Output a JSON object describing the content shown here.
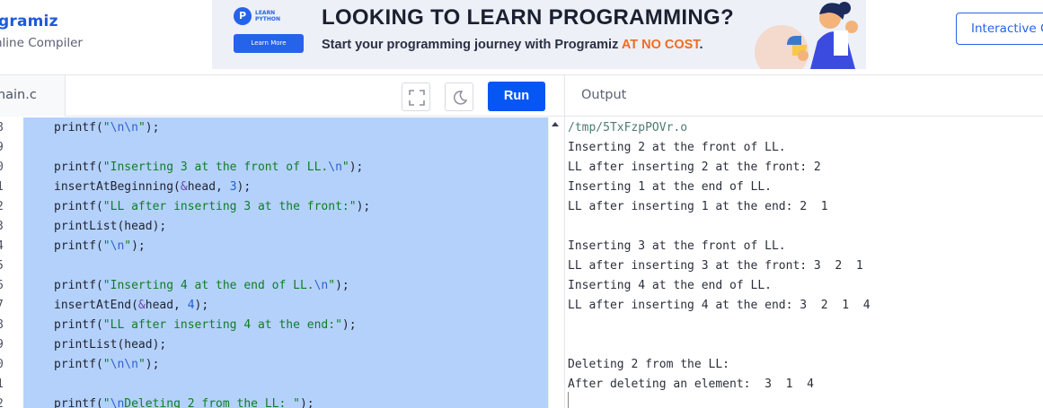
{
  "header": {
    "brand": "gramiz",
    "sub_brand": "nline Compiler",
    "interactive_button": "Interactive C"
  },
  "banner": {
    "logo_text_1": "LEARN",
    "logo_text_2": "PYTHON",
    "learn_more": "Learn More",
    "headline": "LOOKING TO LEARN PROGRAMMING?",
    "sub_prefix": "Start your programming journey with Programiz ",
    "sub_accent": "AT NO COST",
    "sub_suffix": ".",
    "accent_color": "#f26b21"
  },
  "editor": {
    "file_tab": "main.c",
    "run_label": "Run",
    "fullscreen_icon": "expand-icon",
    "theme_icon": "moon-icon",
    "selection_color": "#b4d1fb",
    "lines": [
      {
        "num": "8",
        "tokens": [
          [
            "plain",
            "printf("
          ],
          [
            "str",
            "\""
          ],
          [
            "esc",
            "\\n\\n"
          ],
          [
            "str",
            "\""
          ],
          [
            "plain",
            ");"
          ]
        ]
      },
      {
        "num": "9",
        "tokens": []
      },
      {
        "num": "0",
        "tokens": [
          [
            "plain",
            "printf("
          ],
          [
            "str",
            "\"Inserting 3 at the front of LL."
          ],
          [
            "esc",
            "\\n"
          ],
          [
            "str",
            "\""
          ],
          [
            "plain",
            ");"
          ]
        ]
      },
      {
        "num": "1",
        "tokens": [
          [
            "plain",
            "insertAtBeginning("
          ],
          [
            "op",
            "&"
          ],
          [
            "plain",
            "head, "
          ],
          [
            "num",
            "3"
          ],
          [
            "plain",
            ");"
          ]
        ]
      },
      {
        "num": "2",
        "tokens": [
          [
            "plain",
            "printf("
          ],
          [
            "str",
            "\"LL after inserting 3 at the front:\""
          ],
          [
            "plain",
            ");"
          ]
        ]
      },
      {
        "num": "3",
        "tokens": [
          [
            "plain",
            "printList(head);"
          ]
        ]
      },
      {
        "num": "4",
        "tokens": [
          [
            "plain",
            "printf("
          ],
          [
            "str",
            "\""
          ],
          [
            "esc",
            "\\n"
          ],
          [
            "str",
            "\""
          ],
          [
            "plain",
            ");"
          ]
        ]
      },
      {
        "num": "5",
        "tokens": []
      },
      {
        "num": "6",
        "tokens": [
          [
            "plain",
            "printf("
          ],
          [
            "str",
            "\"Inserting 4 at the end of LL."
          ],
          [
            "esc",
            "\\n"
          ],
          [
            "str",
            "\""
          ],
          [
            "plain",
            ");"
          ]
        ]
      },
      {
        "num": "7",
        "tokens": [
          [
            "plain",
            "insertAtEnd("
          ],
          [
            "op",
            "&"
          ],
          [
            "plain",
            "head, "
          ],
          [
            "num",
            "4"
          ],
          [
            "plain",
            ");"
          ]
        ]
      },
      {
        "num": "8",
        "tokens": [
          [
            "plain",
            "printf("
          ],
          [
            "str",
            "\"LL after inserting 4 at the end:\""
          ],
          [
            "plain",
            ");"
          ]
        ]
      },
      {
        "num": "9",
        "tokens": [
          [
            "plain",
            "printList(head);"
          ]
        ]
      },
      {
        "num": "0",
        "tokens": [
          [
            "plain",
            "printf("
          ],
          [
            "str",
            "\""
          ],
          [
            "esc",
            "\\n\\n"
          ],
          [
            "str",
            "\""
          ],
          [
            "plain",
            ");"
          ]
        ]
      },
      {
        "num": "1",
        "tokens": []
      },
      {
        "num": "2",
        "tokens": [
          [
            "plain",
            "printf("
          ],
          [
            "str",
            "\""
          ],
          [
            "esc",
            "\\n"
          ],
          [
            "str",
            "Deleting 2 from the LL: \""
          ],
          [
            "plain",
            ");"
          ]
        ]
      }
    ]
  },
  "output": {
    "title": "Output",
    "lines": [
      "/tmp/5TxFzpPOVr.o",
      "Inserting 2 at the front of LL.",
      "LL after inserting 2 at the front: 2",
      "Inserting 1 at the end of LL.",
      "LL after inserting 1 at the end: 2  1",
      "",
      "Inserting 3 at the front of LL.",
      "LL after inserting 3 at the front: 3  2  1",
      "Inserting 4 at the end of LL.",
      "LL after inserting 4 at the end: 3  2  1  4",
      "",
      "",
      "Deleting 2 from the LL:",
      "After deleting an element:  3  1  4"
    ]
  }
}
